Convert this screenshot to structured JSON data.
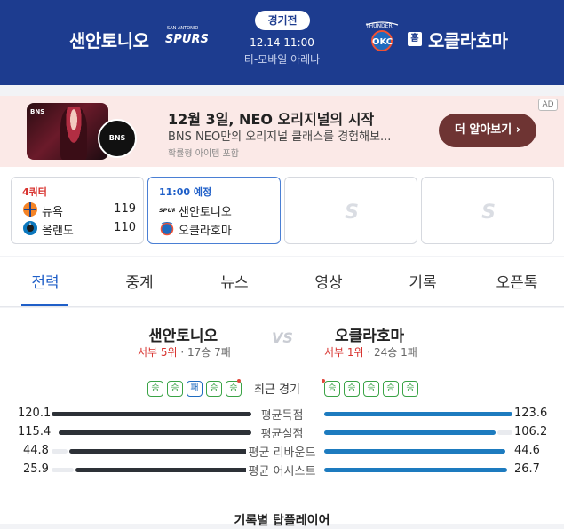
{
  "header": {
    "home_team": "샌안토니오",
    "away_team": "오클라호마",
    "home_logo_icon": "spurs-logo",
    "away_logo_icon": "thunder-logo",
    "home_logo_text": "SPURS",
    "away_logo_text": "OKC",
    "home_badge": "홈",
    "status": "경기전",
    "datetime": "12.14 11:00",
    "venue": "티-모바일 아레나",
    "bg_color": "#1d3c8f"
  },
  "ad": {
    "title": "12월 3일, NEO 오리지널의 시작",
    "desc": "BNS NEO만의 오리지널 클래스를 경험해보...",
    "sub": "확률형 아이템 포함",
    "cta": "더 알아보기 ›",
    "tag": "AD",
    "thumb_text": "BNS",
    "circle_text": "BNS NEO"
  },
  "scoreboard": [
    {
      "status": "4쿼터",
      "teams": [
        {
          "name": "뉴욕",
          "score": "119",
          "icon": "knicks-logo"
        },
        {
          "name": "올랜도",
          "score": "110",
          "icon": "magic-logo"
        }
      ]
    },
    {
      "status": "11:00 예정",
      "teams": [
        {
          "name": "샌안토니오",
          "score": "",
          "icon": "spurs-logo"
        },
        {
          "name": "오클라호마",
          "score": "",
          "icon": "thunder-logo"
        }
      ]
    },
    {
      "placeholder": "S"
    },
    {
      "placeholder": "S"
    }
  ],
  "tabs": [
    "전력",
    "중계",
    "뉴스",
    "영상",
    "기록",
    "오픈톡"
  ],
  "matchup": {
    "home": {
      "name": "샌안토니오",
      "rank": "서부 5위",
      "record": "· 17승 7패"
    },
    "away": {
      "name": "오클라호마",
      "rank": "서부 1위",
      "record": "· 24승 1패"
    },
    "vs": "VS",
    "recent_label": "최근 경기",
    "home_recent": [
      "승",
      "승",
      "패",
      "승",
      "승"
    ],
    "away_recent": [
      "승",
      "승",
      "승",
      "승",
      "승"
    ],
    "stats": [
      {
        "label": "평균득점",
        "home": "120.1",
        "away": "123.6"
      },
      {
        "label": "평균실점",
        "home": "115.4",
        "away": "106.2"
      },
      {
        "label": "평균 리바운드",
        "home": "44.8",
        "away": "44.6"
      },
      {
        "label": "평균 어시스트",
        "home": "25.9",
        "away": "26.7"
      }
    ],
    "footer": "기록별 탑플레이어"
  }
}
